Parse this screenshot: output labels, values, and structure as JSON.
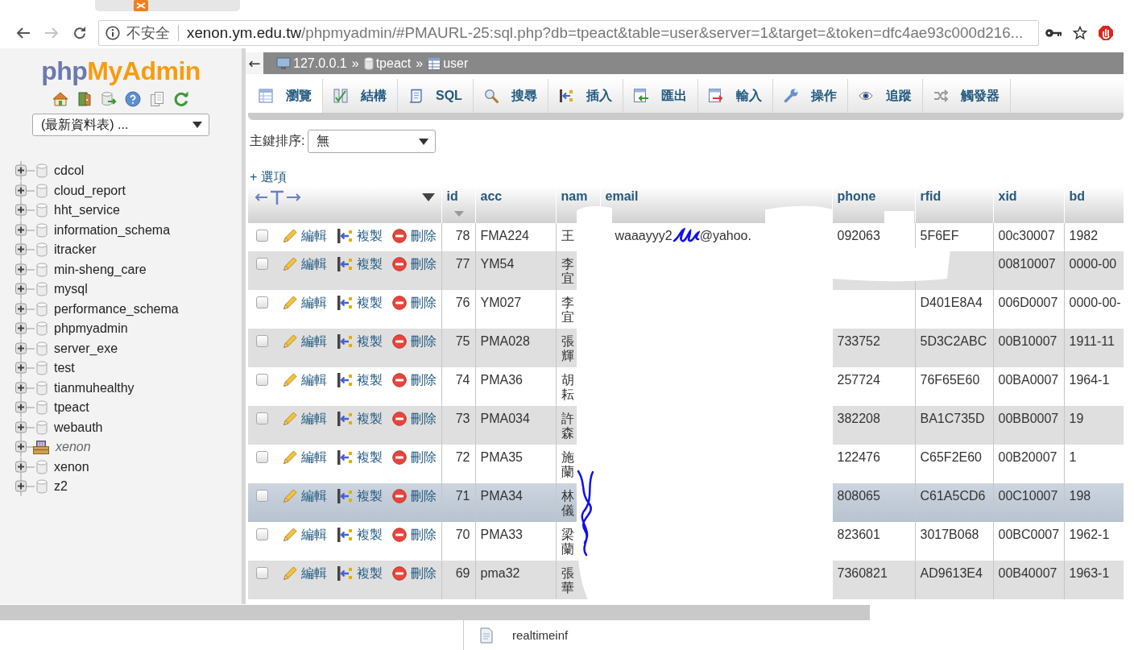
{
  "browser": {
    "forward_button": {
      "disabled": true
    },
    "security_label": "不安全",
    "address": {
      "host": "xenon.ym.edu.tw",
      "path": "/phpmyadmin/#PMAURL-25:sql.php?db=tpeact&table=user&server=1&target=&token=dfc4ae93c000d216..."
    }
  },
  "sidebar": {
    "logo": {
      "first": "php",
      "second": "MyAdmin"
    },
    "recent_tables": "(最新資料表) ...",
    "databases": [
      {
        "name": "cdcol",
        "kind": "database",
        "expanded": false
      },
      {
        "name": "cloud_report",
        "kind": "database",
        "expanded": false
      },
      {
        "name": "hht_service",
        "kind": "database",
        "expanded": false
      },
      {
        "name": "information_schema",
        "kind": "database",
        "expanded": false
      },
      {
        "name": "itracker",
        "kind": "database",
        "expanded": false
      },
      {
        "name": "min-sheng_care",
        "kind": "database",
        "expanded": false
      },
      {
        "name": "mysql",
        "kind": "database",
        "expanded": false
      },
      {
        "name": "performance_schema",
        "kind": "database",
        "expanded": false
      },
      {
        "name": "phpmyadmin",
        "kind": "database",
        "expanded": false
      },
      {
        "name": "server_exe",
        "kind": "database",
        "expanded": false
      },
      {
        "name": "test",
        "kind": "database",
        "expanded": false
      },
      {
        "name": "tianmuhealthy",
        "kind": "database",
        "expanded": false
      },
      {
        "name": "tpeact",
        "kind": "database",
        "expanded": false
      },
      {
        "name": "webauth",
        "kind": "database",
        "expanded": false
      },
      {
        "name": "xenon",
        "kind": "group",
        "expanded": false
      },
      {
        "name": "xenon",
        "kind": "database",
        "expanded": false
      },
      {
        "name": "z2",
        "kind": "database",
        "expanded": false
      }
    ]
  },
  "main": {
    "back_button": "←",
    "breadcrumb": [
      {
        "kind": "server",
        "label": "127.0.0.1",
        "separator": "»"
      },
      {
        "kind": "database",
        "label": "tpeact",
        "separator": "»"
      },
      {
        "kind": "table",
        "label": "user"
      }
    ],
    "tabs": [
      {
        "kind": "browse",
        "label": "瀏覽",
        "selected": true
      },
      {
        "kind": "structure",
        "label": "結構",
        "selected": false
      },
      {
        "kind": "sql",
        "label": "SQL",
        "selected": false
      },
      {
        "kind": "search",
        "label": "搜尋",
        "selected": false
      },
      {
        "kind": "insert",
        "label": "插入",
        "selected": false
      },
      {
        "kind": "export",
        "label": "匯出",
        "selected": false
      },
      {
        "kind": "import",
        "label": "輸入",
        "selected": false
      },
      {
        "kind": "operations",
        "label": "操作",
        "selected": false
      },
      {
        "kind": "tracking",
        "label": "追蹤",
        "selected": false
      },
      {
        "kind": "triggers",
        "label": "觸發器",
        "selected": false
      }
    ],
    "sort_by_key": {
      "label": "主鍵排序:",
      "value": "無"
    },
    "options_link": "+ 選項",
    "table": {
      "columns": [
        {
          "label": "id",
          "sorted": true
        },
        {
          "label": "acc",
          "sorted": false
        },
        {
          "label": "nam",
          "sorted": false
        },
        {
          "label": "email",
          "sorted": false
        },
        {
          "label": "phone",
          "sorted": false
        },
        {
          "label": "rfid",
          "sorted": false
        },
        {
          "label": "xid",
          "sorted": false
        },
        {
          "label": "bd",
          "sorted": false
        }
      ],
      "rows": [
        {
          "checked": false,
          "highlighted": false,
          "actions": [
            {
              "kind": "edit",
              "label": "編輯"
            },
            {
              "kind": "copy",
              "label": "複製"
            },
            {
              "kind": "delete",
              "label": "刪除"
            }
          ],
          "cells": {
            "id": "78",
            "acc": "FMA224",
            "name": "王",
            "email": {
              "before": "waaayyy2",
              "after": "@yahoo."
            },
            "phone": "092063",
            "rfid": "5F6EF",
            "xid": "00c30007",
            "bd": "1982"
          }
        },
        {
          "checked": false,
          "highlighted": false,
          "actions": [
            {
              "kind": "edit",
              "label": "編輯"
            },
            {
              "kind": "copy",
              "label": "複製"
            },
            {
              "kind": "delete",
              "label": "刪除"
            }
          ],
          "cells": {
            "id": "77",
            "acc": "YM54",
            "name": "李宜",
            "xid": "00810007",
            "bd": "0000-00"
          }
        },
        {
          "checked": false,
          "highlighted": false,
          "actions": [
            {
              "kind": "edit",
              "label": "編輯"
            },
            {
              "kind": "copy",
              "label": "複製"
            },
            {
              "kind": "delete",
              "label": "刪除"
            }
          ],
          "cells": {
            "id": "76",
            "acc": "YM027",
            "name": "李宜",
            "rfid": "D401E8A4",
            "xid": "006D0007",
            "bd": "0000-00-"
          }
        },
        {
          "checked": false,
          "highlighted": false,
          "actions": [
            {
              "kind": "edit",
              "label": "編輯"
            },
            {
              "kind": "copy",
              "label": "複製"
            },
            {
              "kind": "delete",
              "label": "刪除"
            }
          ],
          "cells": {
            "id": "75",
            "acc": "PMA028",
            "name": "張輝",
            "phone": "733752",
            "rfid": "5D3C2ABC",
            "xid": "00B10007",
            "bd": "1911-11"
          }
        },
        {
          "checked": false,
          "highlighted": false,
          "actions": [
            {
              "kind": "edit",
              "label": "編輯"
            },
            {
              "kind": "copy",
              "label": "複製"
            },
            {
              "kind": "delete",
              "label": "刪除"
            }
          ],
          "cells": {
            "id": "74",
            "acc": "PMA36",
            "name": "胡耘",
            "phone": "257724",
            "rfid": "76F65E60",
            "xid": "00BA0007",
            "bd": "1964-1"
          }
        },
        {
          "checked": false,
          "highlighted": false,
          "actions": [
            {
              "kind": "edit",
              "label": "編輯"
            },
            {
              "kind": "copy",
              "label": "複製"
            },
            {
              "kind": "delete",
              "label": "刪除"
            }
          ],
          "cells": {
            "id": "73",
            "acc": "PMA034",
            "name": "許森",
            "phone": "382208",
            "rfid": "BA1C735D",
            "xid": "00BB0007",
            "bd": "19"
          }
        },
        {
          "checked": false,
          "highlighted": false,
          "actions": [
            {
              "kind": "edit",
              "label": "編輯"
            },
            {
              "kind": "copy",
              "label": "複製"
            },
            {
              "kind": "delete",
              "label": "刪除"
            }
          ],
          "cells": {
            "id": "72",
            "acc": "PMA35",
            "name": "施蘭",
            "phone": "122476",
            "rfid": "C65F2E60",
            "xid": "00B20007",
            "bd": "1"
          }
        },
        {
          "checked": false,
          "highlighted": true,
          "actions": [
            {
              "kind": "edit",
              "label": "編輯"
            },
            {
              "kind": "copy",
              "label": "複製"
            },
            {
              "kind": "delete",
              "label": "刪除"
            }
          ],
          "cells": {
            "id": "71",
            "acc": "PMA34",
            "name": "林儀",
            "phone": "808065",
            "rfid": "C61A5CD6",
            "xid": "00C10007",
            "bd": "198"
          }
        },
        {
          "checked": false,
          "highlighted": false,
          "actions": [
            {
              "kind": "edit",
              "label": "編輯"
            },
            {
              "kind": "copy",
              "label": "複製"
            },
            {
              "kind": "delete",
              "label": "刪除"
            }
          ],
          "cells": {
            "id": "70",
            "acc": "PMA33",
            "name": "梁蘭",
            "phone": "823601",
            "rfid": "3017B068",
            "xid": "00BC0007",
            "bd": "1962-1"
          }
        },
        {
          "checked": false,
          "highlighted": false,
          "actions": [
            {
              "kind": "edit",
              "label": "編輯"
            },
            {
              "kind": "copy",
              "label": "複製"
            },
            {
              "kind": "delete",
              "label": "刪除"
            }
          ],
          "cells": {
            "id": "69",
            "acc": "pma32",
            "name": "張華",
            "phone": "7360821",
            "rfid": "AD9613E4",
            "xid": "00B40007",
            "bd": "1963-1"
          }
        }
      ]
    }
  },
  "downloads": [
    {
      "name": "realtimeinf"
    }
  ]
}
